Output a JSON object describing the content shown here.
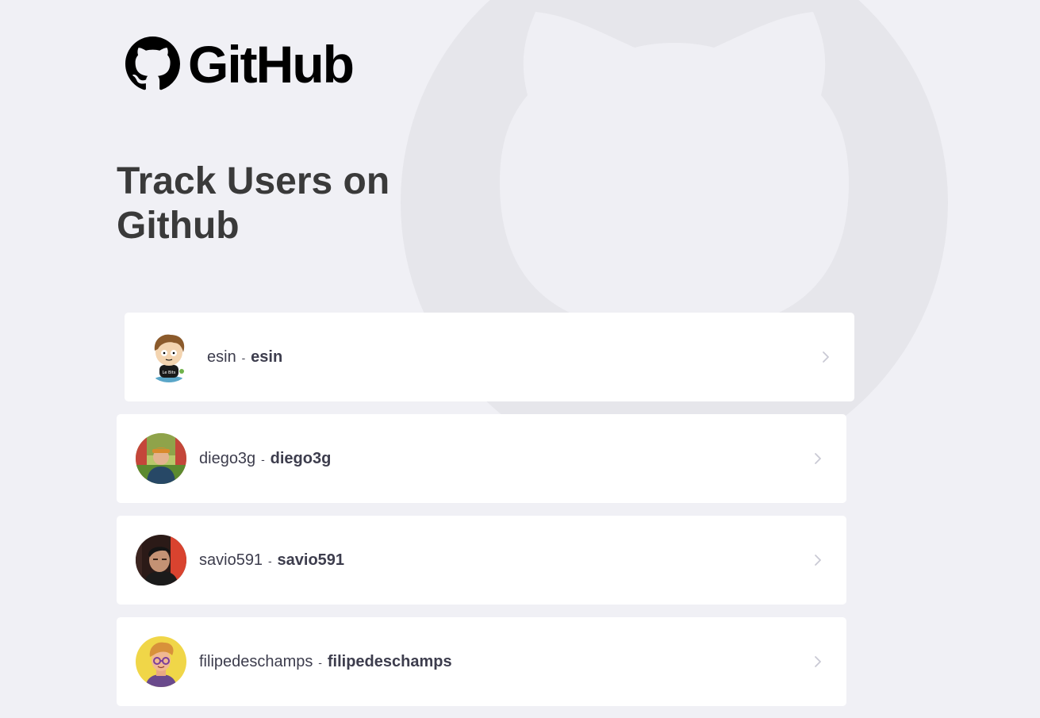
{
  "brand": {
    "wordmark": "GitHub"
  },
  "page_title": "Track Users on Github",
  "users": [
    {
      "name": "esin",
      "login": "esin",
      "separator": "-"
    },
    {
      "name": "diego3g",
      "login": "diego3g",
      "separator": "-"
    },
    {
      "name": "savio591",
      "login": "savio591",
      "separator": "-"
    },
    {
      "name": "filipedeschamps",
      "login": "filipedeschamps",
      "separator": "-"
    }
  ],
  "colors": {
    "background": "#f0f0f5",
    "card": "#ffffff",
    "title_text": "#3a3a3a",
    "card_text": "#3d3d4d",
    "chevron": "#c9c9d4",
    "watermark": "#e6e6eb"
  },
  "icons": {
    "logo": "github-octocat-icon",
    "watermark": "github-octocat-watermark-icon",
    "card_action": "chevron-right-icon"
  }
}
